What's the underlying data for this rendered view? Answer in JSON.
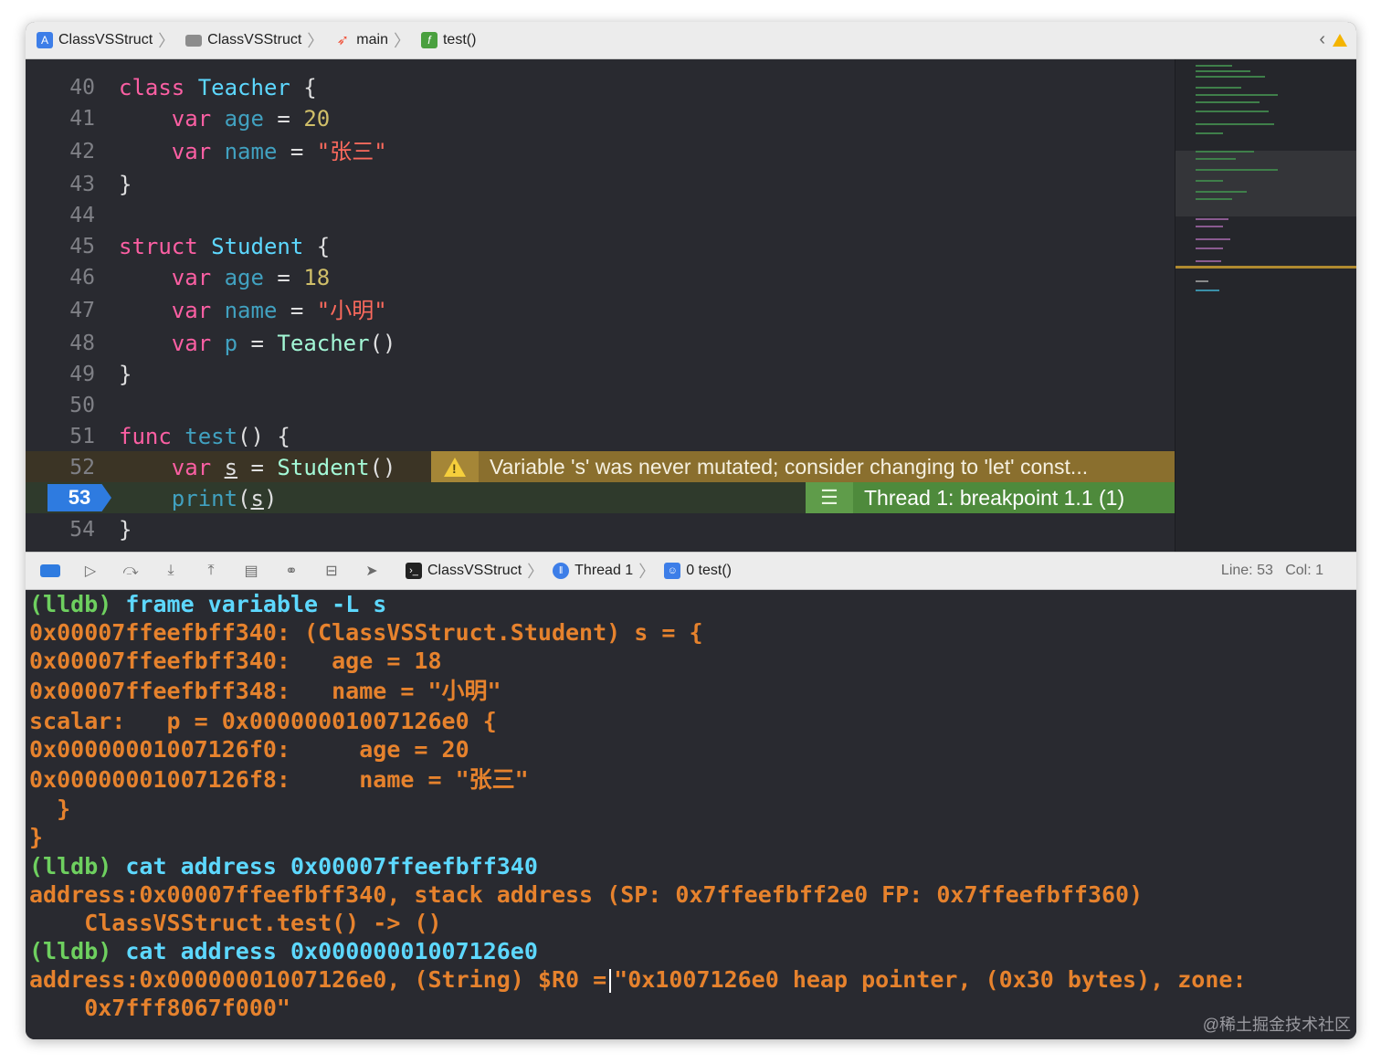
{
  "jumpbar": {
    "crumbs": [
      "ClassVSStruct",
      "ClassVSStruct",
      "main",
      "test()"
    ]
  },
  "editor": {
    "line_numbers": [
      "40",
      "41",
      "42",
      "43",
      "44",
      "45",
      "46",
      "47",
      "48",
      "49",
      "50",
      "51",
      "52",
      "53",
      "54"
    ],
    "code": {
      "l40": {
        "kw": "class",
        "name": "Teacher",
        "rest": " {"
      },
      "l41": {
        "kw": "var",
        "name": "age",
        "eq": " = ",
        "val": "20"
      },
      "l42": {
        "kw": "var",
        "name": "name",
        "eq": " = ",
        "val": "\"张三\""
      },
      "l43": "}",
      "l45": {
        "kw": "struct",
        "name": "Student",
        "rest": " {"
      },
      "l46": {
        "kw": "var",
        "name": "age",
        "eq": " = ",
        "val": "18"
      },
      "l47": {
        "kw": "var",
        "name": "name",
        "eq": " = ",
        "val": "\"小明\""
      },
      "l48": {
        "kw": "var",
        "name": "p",
        "eq": " = ",
        "call": "Teacher",
        "rest": "()"
      },
      "l49": "}",
      "l51": {
        "kw": "func",
        "name": "test",
        "rest": "() {"
      },
      "l52": {
        "kw": "var",
        "name": "s",
        "eq": " = ",
        "call": "Student",
        "rest": "()"
      },
      "l53": {
        "fn": "print",
        "open": "(",
        "arg": "s",
        "close": ")"
      },
      "l54": "}"
    },
    "warning_message": "Variable 's' was never mutated; consider changing to 'let' const...",
    "breakpoint_message": "Thread 1: breakpoint 1.1 (1)",
    "breakpoint_line": "53"
  },
  "debugbar": {
    "crumbs": [
      "ClassVSStruct",
      "Thread 1",
      "0 test()"
    ],
    "line_label": "Line: 53",
    "col_label": "Col: 1"
  },
  "console": {
    "lines": [
      {
        "prompt": "(lldb)",
        "cmd": "frame variable -L s"
      },
      {
        "text": "0x00007ffeefbff340: (ClassVSStruct.Student) s = {"
      },
      {
        "text": "0x00007ffeefbff340:   age = 18"
      },
      {
        "text": "0x00007ffeefbff348:   name = \"小明\""
      },
      {
        "text": "scalar:   p = 0x00000001007126e0 {"
      },
      {
        "text": "0x00000001007126f0:     age = 20"
      },
      {
        "text": "0x00000001007126f8:     name = \"张三\""
      },
      {
        "text": "  }"
      },
      {
        "text": "}"
      },
      {
        "prompt": "(lldb)",
        "cmd": "cat address 0x00007ffeefbff340"
      },
      {
        "text": "address:0x00007ffeefbff340, stack address (SP: 0x7ffeefbff2e0 FP: 0x7ffeefbff360)"
      },
      {
        "text": "    ClassVSStruct.test() -> ()"
      },
      {
        "prompt": "(lldb)",
        "cmd": "cat address 0x00000001007126e0"
      },
      {
        "text_a": "address:0x00000001007126e0, (String) $R0 =",
        "text_b": "\"0x1007126e0 heap pointer, (0x30 bytes), zone:"
      },
      {
        "text": "    0x7fff8067f000\""
      }
    ],
    "watermark": "@稀土掘金技术社区"
  },
  "colors": {
    "editor_bg": "#292a30",
    "keyword": "#fc5fa3",
    "type": "#5dd8ff",
    "string": "#fc6a5d",
    "number": "#d0bf69",
    "warning": "#8a6f2e",
    "breakpoint": "#4e8a3c",
    "console_output": "#e6822d",
    "console_prompt": "#6ed05f"
  }
}
